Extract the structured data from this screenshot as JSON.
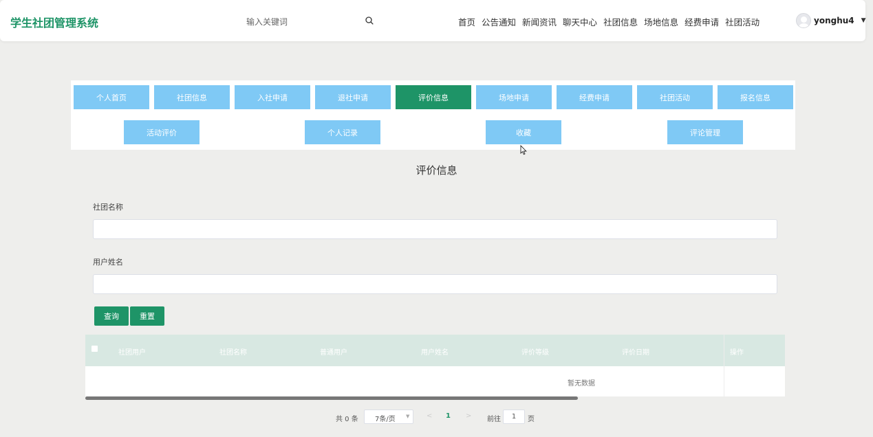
{
  "header": {
    "title": "学生社团管理系统",
    "search_placeholder": "输入关键词",
    "nav": [
      "首页",
      "公告通知",
      "新闻资讯",
      "聊天中心",
      "社团信息",
      "场地信息",
      "经费申请",
      "社团活动"
    ],
    "username": "yonghu4"
  },
  "tabs": {
    "row1": [
      "个人首页",
      "社团信息",
      "入社申请",
      "退社申请",
      "评价信息",
      "场地申请",
      "经费申请",
      "社团活动",
      "报名信息"
    ],
    "row2": [
      "活动评价",
      "个人记录",
      "收藏",
      "评论管理"
    ],
    "active": "评价信息"
  },
  "main": {
    "title": "评价信息",
    "fields": {
      "club_name_label": "社团名称",
      "club_name_value": "",
      "user_name_label": "用户姓名",
      "user_name_value": ""
    },
    "buttons": {
      "query": "查询",
      "reset": "重置"
    }
  },
  "table": {
    "columns": [
      "社团用户",
      "社团名称",
      "普通用户",
      "用户姓名",
      "评价等级",
      "评价日期",
      "操作"
    ],
    "empty_text": "暂无数据"
  },
  "pagination": {
    "total": "共 0 条",
    "page_size": "7条/页",
    "current_page": "1",
    "goto_label": "前往",
    "goto_value": "1",
    "page_suffix": "页"
  },
  "colors": {
    "primary": "#1e9467",
    "tab": "#7fc9f5",
    "table_header": "#d8e8e2"
  }
}
